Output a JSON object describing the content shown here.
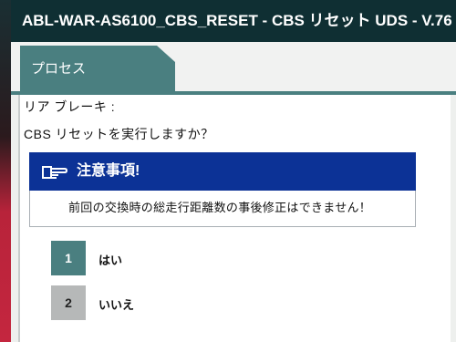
{
  "window": {
    "title": "ABL-WAR-AS6100_CBS_RESET - CBS リセット UDS - V.76"
  },
  "tabs": [
    {
      "label": "プロセス"
    }
  ],
  "content": {
    "line1": "リア ブレーキ :",
    "line2": "CBS リセットを実行しますか？",
    "notice": {
      "icon": "pointing-hand-icon",
      "title": "注意事項!",
      "body": "前回の交換時の総走行距離数の事後修正はできません！"
    },
    "options": [
      {
        "number": "1",
        "label": "はい"
      },
      {
        "number": "2",
        "label": "いいえ"
      }
    ]
  },
  "colors": {
    "titlebar_bg": "#0f2f33",
    "tab_accent": "#4a7f80",
    "notice_bg": "#0c3296",
    "button_secondary": "#b6b8b8"
  }
}
